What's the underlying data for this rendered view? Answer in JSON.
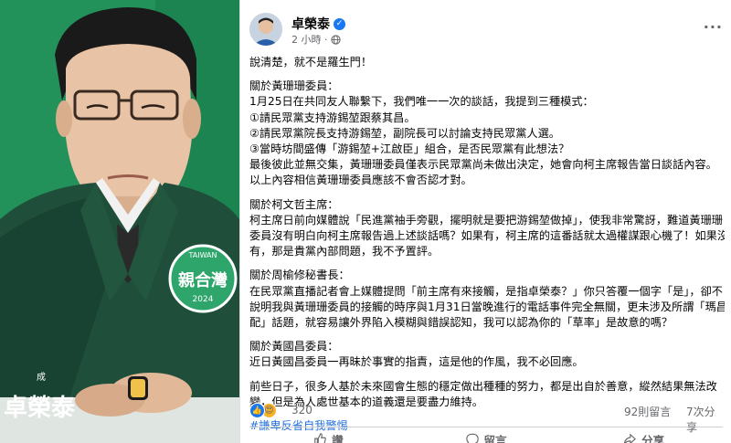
{
  "photo": {
    "badge_text": "親合灣",
    "badge_year": "2024",
    "badge_top": "TAIWAN",
    "jacket_name": "卓榮泰",
    "jacket_small": "成"
  },
  "post": {
    "author": "卓榮泰",
    "verified_mark": "✓",
    "time": "2 小時 ·",
    "more_icon": "···",
    "lines": [
      "說清楚，就不是羅生門！",
      "",
      "關於黃珊珊委員：",
      "1月25日在共同友人聯繫下，我們唯一一次的談話，我提到三種模式：",
      "①請民眾黨支持游錫堃跟蔡其昌。",
      "②請民眾黨院長支持游錫堃，副院長可以討論支持民眾黨人選。",
      "③當時坊間盛傳「游錫堃+江啟臣」組合，是否民眾黨有此想法？",
      "最後彼此並無交集，黃珊珊委員僅表示民眾黨尚未做出決定，她會向柯主席報告當日談話內容。",
      "以上內容相信黃珊珊委員應該不會否認才對。",
      "",
      "關於柯文哲主席：",
      "柯主席日前向媒體說「民進黨袖手旁觀，擺明就是要把游錫堃做掉」，使我非常驚訝，難道黃珊珊",
      "委員沒有明白向柯主席報告過上述談話嗎？如果有，柯主席的這番話就太過權謀跟心機了！如果沒",
      "有，那是貴黨內部問題，我不予置評。",
      "",
      "關於周榆修秘書長：",
      "在民眾黨直播記者會上媒體提問「前主席有來接觸，是指卓榮泰？」你只答覆一個字「是」，卻不",
      "說明我與黃珊珊委員的接觸的時序與1月31日當晚進行的電話事件完全無關，更未涉及所謂「瑪昌",
      "配」話題，就容易讓外界陷入模糊與錯誤認知，我可以認為你的「草率」是故意的嗎？",
      "",
      "關於黃國昌委員：",
      "近日黃國昌委員一再昧於事實的指責，這是他的作風，我不必回應。",
      "",
      "前些日子，很多人基於未來國會生態的穩定做出種種的努力，都是出自於善意，縱然結果無法改",
      "變，但是為人處世基本的道義還是要盡力維持。",
      "",
      "#謙卑反省自我警惕"
    ],
    "reactions": {
      "like_icon": "👍",
      "love_icon": "😍",
      "count": "320",
      "comments": "92則留言",
      "shares": "7次分享"
    },
    "actions": {
      "like": "讚",
      "comment": "留言",
      "share": "分享"
    }
  }
}
